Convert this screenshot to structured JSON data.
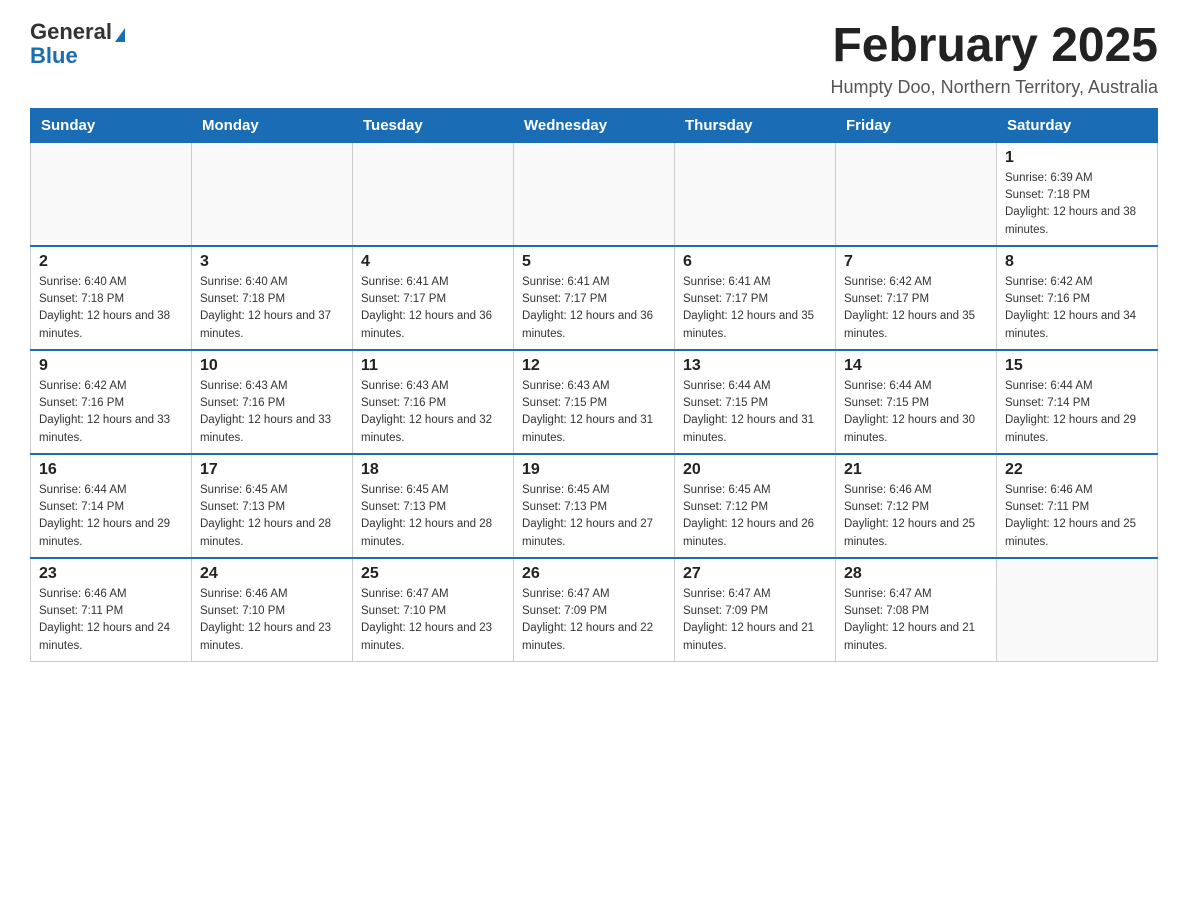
{
  "logo": {
    "general": "General",
    "blue": "Blue"
  },
  "header": {
    "month_title": "February 2025",
    "location": "Humpty Doo, Northern Territory, Australia"
  },
  "weekdays": [
    "Sunday",
    "Monday",
    "Tuesday",
    "Wednesday",
    "Thursday",
    "Friday",
    "Saturday"
  ],
  "weeks": [
    [
      {
        "day": "",
        "sunrise": "",
        "sunset": "",
        "daylight": ""
      },
      {
        "day": "",
        "sunrise": "",
        "sunset": "",
        "daylight": ""
      },
      {
        "day": "",
        "sunrise": "",
        "sunset": "",
        "daylight": ""
      },
      {
        "day": "",
        "sunrise": "",
        "sunset": "",
        "daylight": ""
      },
      {
        "day": "",
        "sunrise": "",
        "sunset": "",
        "daylight": ""
      },
      {
        "day": "",
        "sunrise": "",
        "sunset": "",
        "daylight": ""
      },
      {
        "day": "1",
        "sunrise": "Sunrise: 6:39 AM",
        "sunset": "Sunset: 7:18 PM",
        "daylight": "Daylight: 12 hours and 38 minutes."
      }
    ],
    [
      {
        "day": "2",
        "sunrise": "Sunrise: 6:40 AM",
        "sunset": "Sunset: 7:18 PM",
        "daylight": "Daylight: 12 hours and 38 minutes."
      },
      {
        "day": "3",
        "sunrise": "Sunrise: 6:40 AM",
        "sunset": "Sunset: 7:18 PM",
        "daylight": "Daylight: 12 hours and 37 minutes."
      },
      {
        "day": "4",
        "sunrise": "Sunrise: 6:41 AM",
        "sunset": "Sunset: 7:17 PM",
        "daylight": "Daylight: 12 hours and 36 minutes."
      },
      {
        "day": "5",
        "sunrise": "Sunrise: 6:41 AM",
        "sunset": "Sunset: 7:17 PM",
        "daylight": "Daylight: 12 hours and 36 minutes."
      },
      {
        "day": "6",
        "sunrise": "Sunrise: 6:41 AM",
        "sunset": "Sunset: 7:17 PM",
        "daylight": "Daylight: 12 hours and 35 minutes."
      },
      {
        "day": "7",
        "sunrise": "Sunrise: 6:42 AM",
        "sunset": "Sunset: 7:17 PM",
        "daylight": "Daylight: 12 hours and 35 minutes."
      },
      {
        "day": "8",
        "sunrise": "Sunrise: 6:42 AM",
        "sunset": "Sunset: 7:16 PM",
        "daylight": "Daylight: 12 hours and 34 minutes."
      }
    ],
    [
      {
        "day": "9",
        "sunrise": "Sunrise: 6:42 AM",
        "sunset": "Sunset: 7:16 PM",
        "daylight": "Daylight: 12 hours and 33 minutes."
      },
      {
        "day": "10",
        "sunrise": "Sunrise: 6:43 AM",
        "sunset": "Sunset: 7:16 PM",
        "daylight": "Daylight: 12 hours and 33 minutes."
      },
      {
        "day": "11",
        "sunrise": "Sunrise: 6:43 AM",
        "sunset": "Sunset: 7:16 PM",
        "daylight": "Daylight: 12 hours and 32 minutes."
      },
      {
        "day": "12",
        "sunrise": "Sunrise: 6:43 AM",
        "sunset": "Sunset: 7:15 PM",
        "daylight": "Daylight: 12 hours and 31 minutes."
      },
      {
        "day": "13",
        "sunrise": "Sunrise: 6:44 AM",
        "sunset": "Sunset: 7:15 PM",
        "daylight": "Daylight: 12 hours and 31 minutes."
      },
      {
        "day": "14",
        "sunrise": "Sunrise: 6:44 AM",
        "sunset": "Sunset: 7:15 PM",
        "daylight": "Daylight: 12 hours and 30 minutes."
      },
      {
        "day": "15",
        "sunrise": "Sunrise: 6:44 AM",
        "sunset": "Sunset: 7:14 PM",
        "daylight": "Daylight: 12 hours and 29 minutes."
      }
    ],
    [
      {
        "day": "16",
        "sunrise": "Sunrise: 6:44 AM",
        "sunset": "Sunset: 7:14 PM",
        "daylight": "Daylight: 12 hours and 29 minutes."
      },
      {
        "day": "17",
        "sunrise": "Sunrise: 6:45 AM",
        "sunset": "Sunset: 7:13 PM",
        "daylight": "Daylight: 12 hours and 28 minutes."
      },
      {
        "day": "18",
        "sunrise": "Sunrise: 6:45 AM",
        "sunset": "Sunset: 7:13 PM",
        "daylight": "Daylight: 12 hours and 28 minutes."
      },
      {
        "day": "19",
        "sunrise": "Sunrise: 6:45 AM",
        "sunset": "Sunset: 7:13 PM",
        "daylight": "Daylight: 12 hours and 27 minutes."
      },
      {
        "day": "20",
        "sunrise": "Sunrise: 6:45 AM",
        "sunset": "Sunset: 7:12 PM",
        "daylight": "Daylight: 12 hours and 26 minutes."
      },
      {
        "day": "21",
        "sunrise": "Sunrise: 6:46 AM",
        "sunset": "Sunset: 7:12 PM",
        "daylight": "Daylight: 12 hours and 25 minutes."
      },
      {
        "day": "22",
        "sunrise": "Sunrise: 6:46 AM",
        "sunset": "Sunset: 7:11 PM",
        "daylight": "Daylight: 12 hours and 25 minutes."
      }
    ],
    [
      {
        "day": "23",
        "sunrise": "Sunrise: 6:46 AM",
        "sunset": "Sunset: 7:11 PM",
        "daylight": "Daylight: 12 hours and 24 minutes."
      },
      {
        "day": "24",
        "sunrise": "Sunrise: 6:46 AM",
        "sunset": "Sunset: 7:10 PM",
        "daylight": "Daylight: 12 hours and 23 minutes."
      },
      {
        "day": "25",
        "sunrise": "Sunrise: 6:47 AM",
        "sunset": "Sunset: 7:10 PM",
        "daylight": "Daylight: 12 hours and 23 minutes."
      },
      {
        "day": "26",
        "sunrise": "Sunrise: 6:47 AM",
        "sunset": "Sunset: 7:09 PM",
        "daylight": "Daylight: 12 hours and 22 minutes."
      },
      {
        "day": "27",
        "sunrise": "Sunrise: 6:47 AM",
        "sunset": "Sunset: 7:09 PM",
        "daylight": "Daylight: 12 hours and 21 minutes."
      },
      {
        "day": "28",
        "sunrise": "Sunrise: 6:47 AM",
        "sunset": "Sunset: 7:08 PM",
        "daylight": "Daylight: 12 hours and 21 minutes."
      },
      {
        "day": "",
        "sunrise": "",
        "sunset": "",
        "daylight": ""
      }
    ]
  ]
}
